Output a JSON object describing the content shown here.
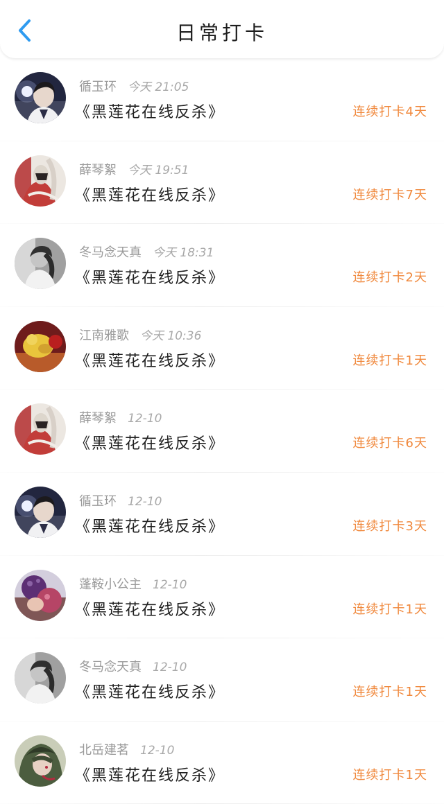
{
  "header": {
    "title": "日常打卡",
    "back_icon": "chevron-left-icon",
    "accent": "#2f9bf0"
  },
  "checkins": [
    {
      "name": "循玉环",
      "time": "今天 21:05",
      "book": "《黑莲花在线反杀》",
      "streak": "连续打卡4天"
    },
    {
      "name": "薛琴絮",
      "time": "今天 19:51",
      "book": "《黑莲花在线反杀》",
      "streak": "连续打卡7天"
    },
    {
      "name": "冬马念天真",
      "time": "今天 18:31",
      "book": "《黑莲花在线反杀》",
      "streak": "连续打卡2天"
    },
    {
      "name": "江南雅歌",
      "time": "今天 10:36",
      "book": "《黑莲花在线反杀》",
      "streak": "连续打卡1天"
    },
    {
      "name": "薛琴絮",
      "time": "12-10",
      "book": "《黑莲花在线反杀》",
      "streak": "连续打卡6天"
    },
    {
      "name": "循玉环",
      "time": "12-10",
      "book": "《黑莲花在线反杀》",
      "streak": "连续打卡3天"
    },
    {
      "name": "蓬鞍小公主",
      "time": "12-10",
      "book": "《黑莲花在线反杀》",
      "streak": "连续打卡1天"
    },
    {
      "name": "冬马念天真",
      "time": "12-10",
      "book": "《黑莲花在线反杀》",
      "streak": "连续打卡1天"
    },
    {
      "name": "北岳建茗",
      "time": "12-10",
      "book": "《黑莲花在线反杀》",
      "streak": "连续打卡1天"
    }
  ],
  "colors": {
    "streak": "#f0883c",
    "meta": "#9a9a9a",
    "book": "#1f1f1f"
  }
}
